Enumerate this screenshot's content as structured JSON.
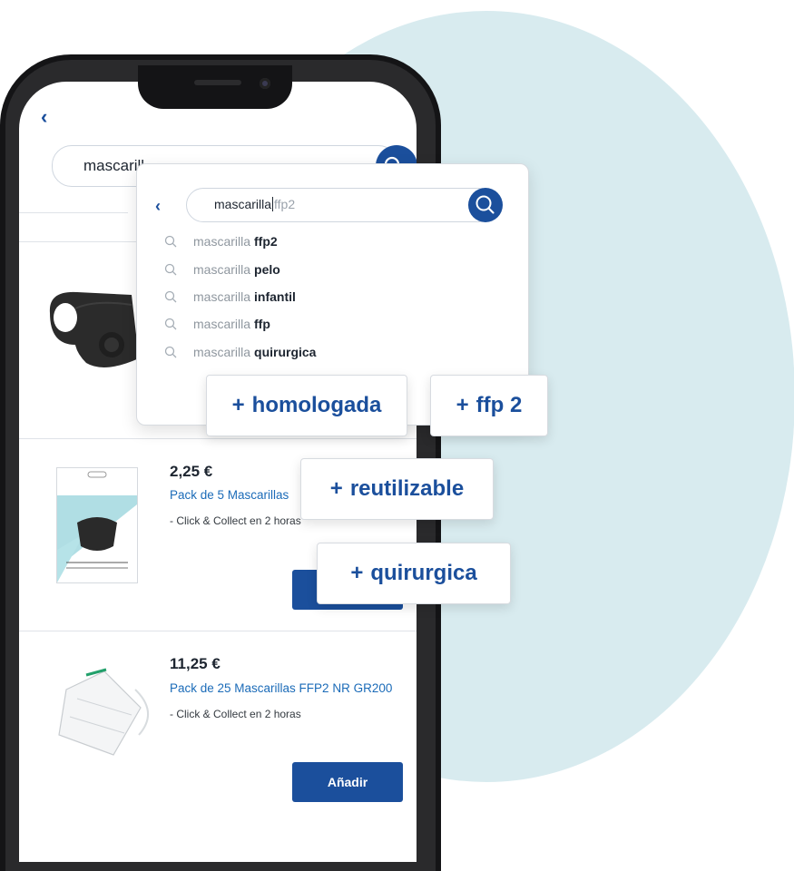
{
  "app": {
    "back_label": "‹",
    "search_query": "mascarill"
  },
  "dropdown": {
    "back_label": "‹",
    "typed": "mascarilla",
    "ghost": "ffp2",
    "suggestions": [
      {
        "base": "mascarilla",
        "bold": "ffp2"
      },
      {
        "base": "mascarilla",
        "bold": "pelo"
      },
      {
        "base": "mascarilla",
        "bold": "infantil"
      },
      {
        "base": "mascarilla",
        "bold": "ffp"
      },
      {
        "base": "mascarilla",
        "bold": "quirurgica"
      }
    ]
  },
  "chips": {
    "plus": "+",
    "items": [
      "homologada",
      "ffp 2",
      "reutilizable",
      "quirurgica"
    ]
  },
  "products": [
    {
      "price": "2,25 €",
      "name": "Pack de 5 Mascarillas",
      "availability": "- Click & Collect en 2 horas"
    },
    {
      "price": "11,25 €",
      "name": "Pack de 25 Mascarillas FFP2 NR GR200",
      "availability": "- Click & Collect en 2 horas",
      "add_label": "Añadir"
    }
  ],
  "colors": {
    "brand_blue": "#1b4f9c",
    "link_blue": "#1b6bb8",
    "blob": "#d8ebef"
  }
}
